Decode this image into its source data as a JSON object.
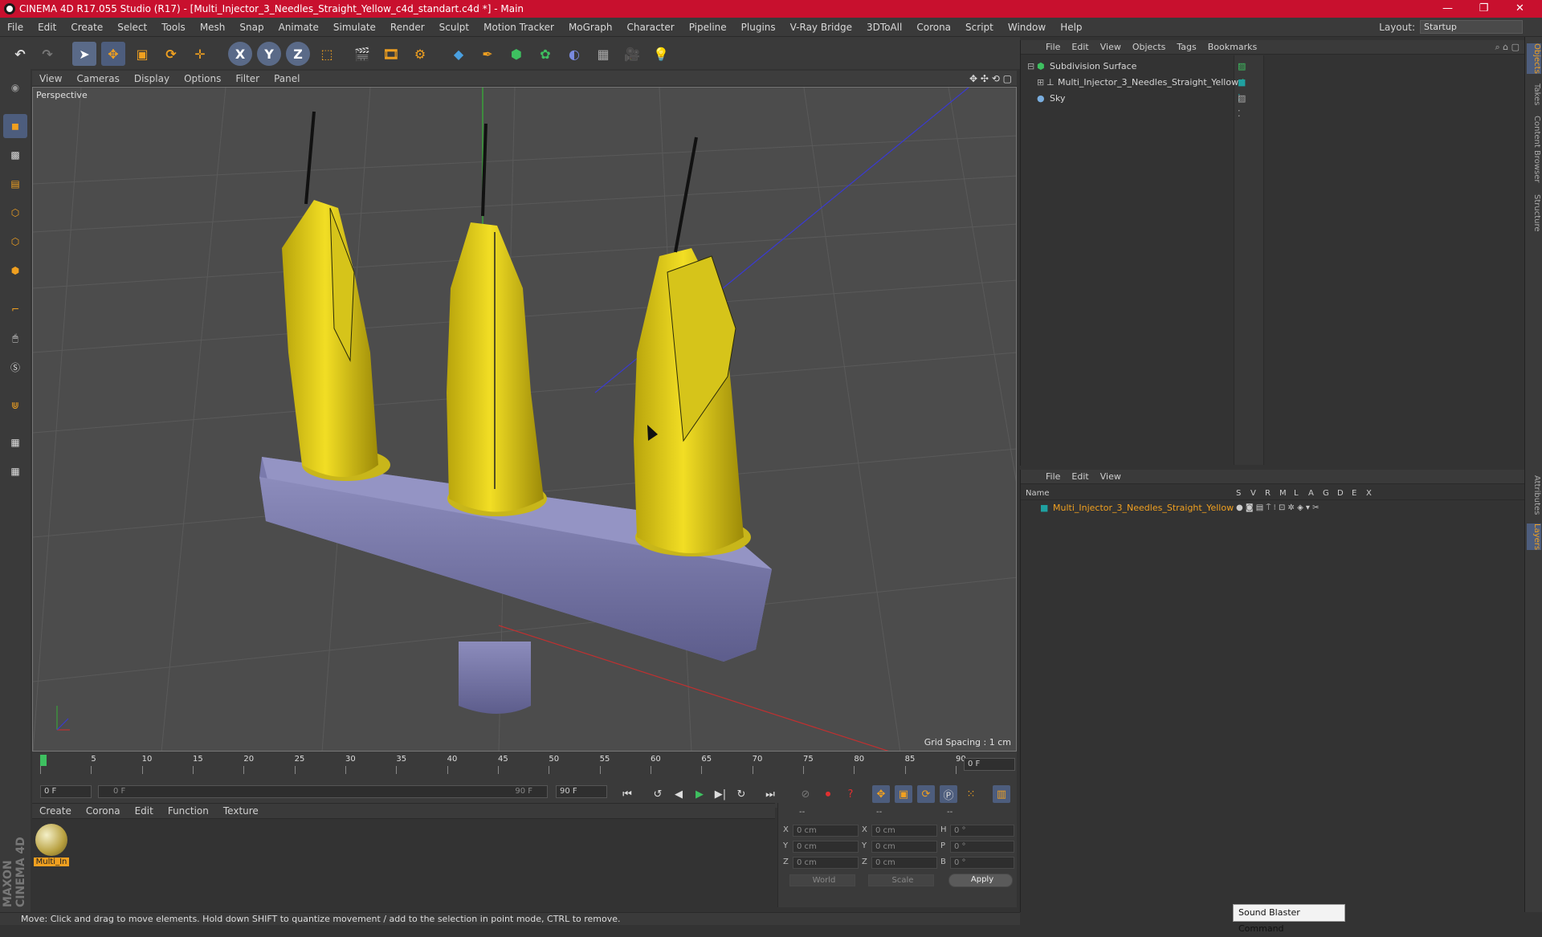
{
  "window": {
    "title": "CINEMA 4D R17.055 Studio (R17) - [Multi_Injector_3_Needles_Straight_Yellow_c4d_standart.c4d *] - Main",
    "minimize": "—",
    "maximize": "❐",
    "close": "✕"
  },
  "menu": [
    "File",
    "Edit",
    "Create",
    "Select",
    "Tools",
    "Mesh",
    "Snap",
    "Animate",
    "Simulate",
    "Render",
    "Sculpt",
    "Motion Tracker",
    "MoGraph",
    "Character",
    "Pipeline",
    "Plugins",
    "V-Ray Bridge",
    "3DToAll",
    "Corona",
    "Script",
    "Window",
    "Help"
  ],
  "layout": {
    "label": "Layout:",
    "value": "Startup"
  },
  "viewport": {
    "menu": [
      "View",
      "Cameras",
      "Display",
      "Options",
      "Filter",
      "Panel"
    ],
    "label": "Perspective",
    "grid_spacing": "Grid Spacing : 1 cm"
  },
  "timeline": {
    "ticks": [
      "0",
      "5",
      "10",
      "15",
      "20",
      "25",
      "30",
      "35",
      "40",
      "45",
      "50",
      "55",
      "60",
      "65",
      "70",
      "75",
      "80",
      "85",
      "90"
    ],
    "current_frame": "0 F",
    "start_field": "0 F",
    "range_start": "0 F",
    "range_end": "90 F",
    "end_field": "90 F"
  },
  "material_manager": {
    "menu": [
      "Create",
      "Corona",
      "Edit",
      "Function",
      "Texture"
    ],
    "materials": [
      {
        "name": "Multi_In"
      }
    ]
  },
  "coordinates": {
    "header": [
      "--",
      "--",
      "--"
    ],
    "rows": [
      {
        "axis": "X",
        "pos": "0 cm",
        "axis2": "X",
        "size": "0 cm",
        "axis3": "H",
        "rot": "0 °"
      },
      {
        "axis": "Y",
        "pos": "0 cm",
        "axis2": "Y",
        "size": "0 cm",
        "axis3": "P",
        "rot": "0 °"
      },
      {
        "axis": "Z",
        "pos": "0 cm",
        "axis2": "Z",
        "size": "0 cm",
        "axis3": "B",
        "rot": "0 °"
      }
    ],
    "world": "World",
    "scale": "Scale",
    "apply": "Apply"
  },
  "object_manager": {
    "menu": [
      "File",
      "Edit",
      "View",
      "Objects",
      "Tags",
      "Bookmarks"
    ],
    "objects": [
      {
        "name": "Subdivision Surface"
      },
      {
        "name": "Multi_Injector_3_Needles_Straight_Yellow"
      },
      {
        "name": "Sky"
      }
    ]
  },
  "layer_manager": {
    "menu": [
      "File",
      "Edit",
      "View"
    ],
    "columns": [
      "Name",
      "S",
      "V",
      "R",
      "M",
      "L",
      "A",
      "G",
      "D",
      "E",
      "X"
    ],
    "layers": [
      {
        "name": "Multi_Injector_3_Needles_Straight_Yellow"
      }
    ]
  },
  "right_tabs": [
    "Objects",
    "Takes",
    "Content Browser",
    "Structure",
    "Attributes",
    "Layers"
  ],
  "status": "Move: Click and drag to move elements. Hold down SHIFT to quantize movement / add to the selection in point mode, CTRL to remove.",
  "tooltip": "Sound Blaster Command",
  "brand": "MAXON CINEMA 4D",
  "colors": {
    "title_red": "#c8102e",
    "accent_orange": "#f0a020",
    "layer_teal": "#1fa0a0",
    "syringe_yellow": "#e8d21a",
    "base_purple": "#7a7aa8"
  }
}
